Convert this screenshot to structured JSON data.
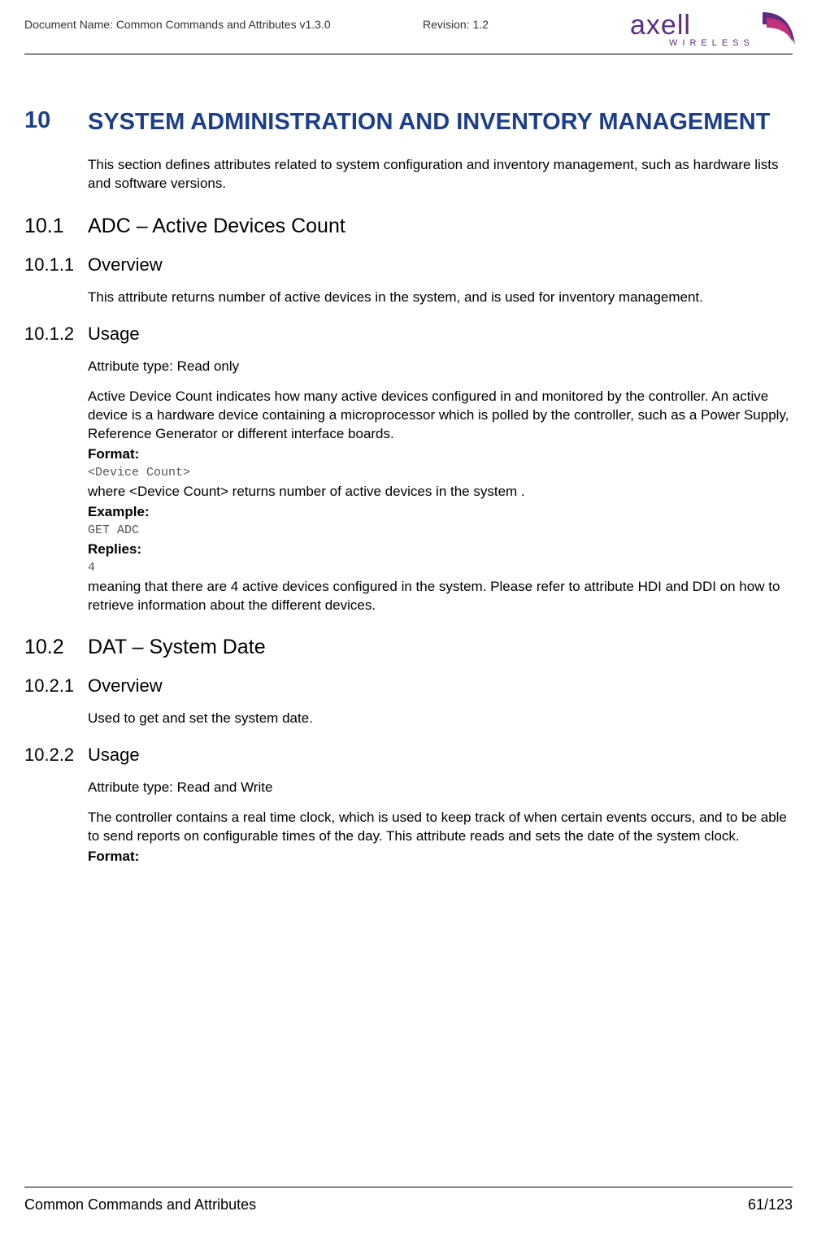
{
  "header": {
    "doc_name_label": "Document Name: Common Commands and Attributes v1.3.0",
    "revision_label": "Revision: 1.2",
    "logo_main": "axell",
    "logo_sub": "WIRELESS"
  },
  "section": {
    "num": "10",
    "title": "SYSTEM ADMINISTRATION AND INVENTORY MANAGEMENT",
    "intro": "This section defines attributes related to system configuration and inventory management, such as hardware lists and software versions."
  },
  "s10_1": {
    "num": "10.1",
    "title": "ADC – Active Devices Count",
    "overview": {
      "num": "10.1.1",
      "title": "Overview",
      "text": "This attribute returns number of active devices in the system, and is used for inventory management."
    },
    "usage": {
      "num": "10.1.2",
      "title": "Usage",
      "attr_type": "Attribute type: Read only",
      "desc": "Active Device Count indicates how many active devices configured in and monitored by the controller. An active device is a hardware device containing a microprocessor which is polled by the controller, such as a Power Supply, Reference Generator or different interface boards.",
      "format_label": "Format:",
      "format_val": "<Device Count>",
      "where": "where <Device Count> returns number of active devices in the system .",
      "example_label": "Example:",
      "example_val": "GET ADC",
      "replies_label": "Replies:",
      "replies_val": "4",
      "meaning": "meaning that there are 4 active devices configured in the system. Please refer to attribute HDI and DDI on how to retrieve information about the different devices."
    }
  },
  "s10_2": {
    "num": "10.2",
    "title": "DAT – System Date",
    "overview": {
      "num": "10.2.1",
      "title": "Overview",
      "text": "Used to get and set the system date."
    },
    "usage": {
      "num": "10.2.2",
      "title": "Usage",
      "attr_type": "Attribute type: Read and Write",
      "desc": "The controller contains a real time clock, which is used to keep track of when certain events occurs, and to be able to send reports on configurable times of the day. This attribute reads and sets the date of the system clock.",
      "format_label": "Format:"
    }
  },
  "footer": {
    "left": "Common Commands and Attributes",
    "right": "61/123"
  }
}
